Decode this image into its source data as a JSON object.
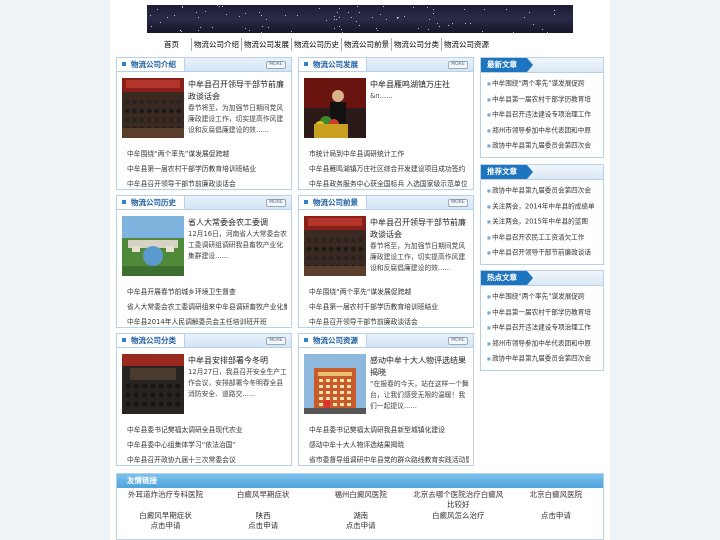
{
  "nav": [
    "首页",
    "物流公司介绍",
    "物流公司发展",
    "物流公司历史",
    "物流公司前景",
    "物流公司分类",
    "物流公司资源"
  ],
  "more_label": "MORE",
  "sections": [
    {
      "title": "物流公司介绍",
      "feature_title": "中牟县召开领导干部节前廉政谈话会",
      "feature_desc": "春节将至，为加强节日期间党风廉政建设工作，切实提高作风建设和反腐倡廉建设的效......",
      "items": [
        "中牟围绕“两个率先”谋发展促跨越",
        "中牟县第一届农村干部学历教育培训班结业",
        "中牟县召开领导干部节前廉政谈话会"
      ]
    },
    {
      "title": "物流公司发展",
      "feature_title": "中牟县雁鸣湖镇万庄社",
      "feature_desc": "&n......",
      "items": [
        "市统计局到中牟县调研统计工作",
        "中牟县雁鸣湖镇万庄社区综合开发建设项目成功签约",
        "中牟县政务服务中心获全国标兵 入选国家级示范单位"
      ]
    },
    {
      "title": "物流公司历史",
      "feature_title": "省人大常委会农工委调",
      "feature_desc": "12月16日，河南省人大常委会农工委调研组调研我县畜牧产业化集群建设......",
      "items": [
        "中牟县开展春节前城乡环境卫生督查",
        "省人大常委会农工委调研组来中牟县调研畜牧产业化集",
        "中牟县2014年人民调解委员会主任培训班开班"
      ]
    },
    {
      "title": "物流公司前景",
      "feature_title": "中牟县召开领导干部节前廉政谈话会",
      "feature_desc": "春节将至，为加强节日期间党风廉政建设工作，切实提高作风建设和反腐倡廉建设的效......",
      "items": [
        "中牟围绕“两个率先”谋发展促跨越",
        "中牟县第一届农村干部学历教育培训班结业",
        "中牟县召开领导干部节前廉政谈话会"
      ]
    },
    {
      "title": "物流公司分类",
      "feature_title": "中牟县安排部署今冬明",
      "feature_desc": "12月27日，我县召开安全生产工作会议，安排部署今冬明春全县消防安全、道路交......",
      "items": [
        "中牟县委书记樊福太调研全县现代农业",
        "中牟县委中心组集体学习“依法治国”",
        "中牟县召开政协九届十三次常委会议"
      ]
    },
    {
      "title": "物流公司资源",
      "feature_title": "感动中牟十大人物评选结果揭晓",
      "feature_desc": "“在报春的今天，站在这样一个舞台，让我们感受无限的温暖！我们一起提议......",
      "items": [
        "中牟县委书记樊福太调研我县新型城镇化建设",
        "感动中牟十大人物评选结果揭晓",
        "省市委督导组调研中牟县党的群众路线教育实践活动暨"
      ]
    }
  ],
  "sidebar": [
    {
      "title": "最新文章",
      "items": [
        "中牟围绕“两个率先”谋发展促跨",
        "中牟县第一届农村干部学历教育培",
        "中牟县召开违法建设专项治理工作",
        "郑州市领导参加中牟代表团和中原",
        "政协中牟县第九届委员会第四次会"
      ]
    },
    {
      "title": "推荐文章",
      "items": [
        "政协中牟县第九届委员会第四次会",
        "关注两会，2014年中牟县的成绩单",
        "关注两会，2015年中牟县的蓝图",
        "中牟县召开农民工工资清欠工作",
        "中牟县召开领导干部节前廉政谈话"
      ]
    },
    {
      "title": "热点文章",
      "items": [
        "中牟围绕“两个率先”谋发展促跨",
        "中牟县第一届农村干部学历教育培",
        "中牟县召开违法建设专项治理工作",
        "郑州市领导参加中牟代表团和中原",
        "政协中牟县第九届委员会第四次会"
      ]
    }
  ],
  "links": {
    "title": "友情链接",
    "row1": [
      "外耳道炸治疗专科医院",
      "白癜风早期症状",
      "福州白癜风医院",
      "北京去哪个医院治疗白癜风比较好",
      "北京白癜风医院"
    ],
    "row2": [
      "白癜风早期症状",
      "陕西",
      "湖南",
      "白癜风怎么治疗",
      "点击申请"
    ],
    "row3": [
      "点击申请",
      "点击申请",
      "点击申请",
      "",
      ""
    ]
  },
  "colors": {
    "accent": "#1f74bf",
    "border": "#b9d1e6",
    "link_head": "#4ea4dd"
  }
}
